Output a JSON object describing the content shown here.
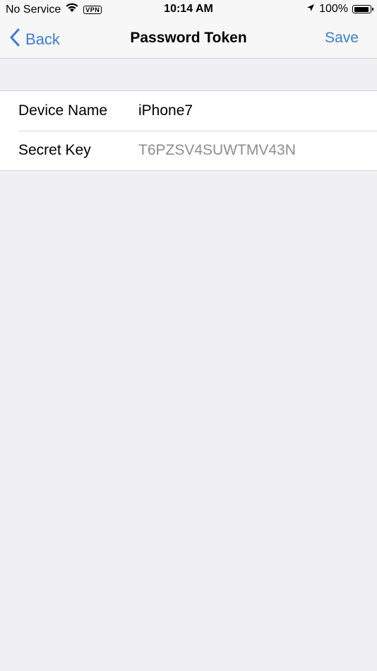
{
  "status_bar": {
    "carrier": "No Service",
    "vpn": "VPN",
    "time": "10:14 AM",
    "battery": "100%"
  },
  "nav": {
    "back_label": "Back",
    "title": "Password Token",
    "save_label": "Save"
  },
  "form": {
    "rows": [
      {
        "label": "Device Name",
        "value": "iPhone7"
      },
      {
        "label": "Secret Key",
        "value": "T6PZSV4SUWTMV43N"
      }
    ]
  },
  "colors": {
    "accent": "#3b7dd8",
    "background": "#efeff4",
    "secondary_text": "#8e8e93"
  }
}
